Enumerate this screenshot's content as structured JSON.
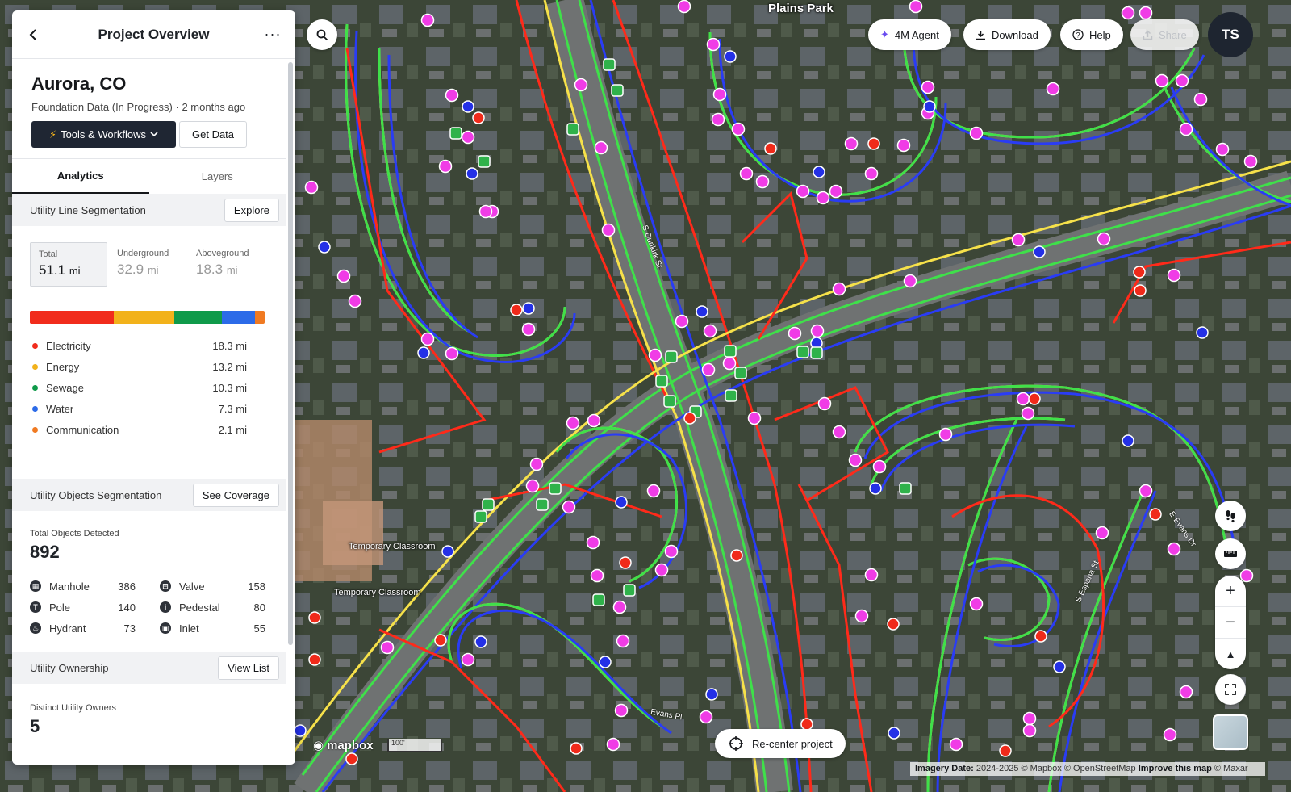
{
  "colors": {
    "electricity": "#f12c1c",
    "energy": "#f2b21b",
    "sewage": "#0f9a4a",
    "water": "#2c6be8",
    "communication": "#f07a22",
    "map_green": "#3fe04a",
    "map_yellow": "#f6e14a",
    "map_blue": "#2a3cf5",
    "map_red": "#ff2a1a",
    "marker_magenta": "#f03ce6"
  },
  "map": {
    "place_label": "Plains Park",
    "labels": [
      "Temporary Classroom",
      "Temporary Classroom"
    ],
    "streets": [
      "S Dunkirk St",
      "E Evans Dr",
      "S Espana St",
      "Evans Pl"
    ],
    "attribution_date_label": "Imagery Date:",
    "attribution_date": "2024-2025",
    "attribution_rest": "© Mapbox © OpenStreetMap",
    "attribution_link": "Improve this map",
    "attribution_tail": "© Maxar",
    "mapbox_logo": "mapbox",
    "scale_label": "100'"
  },
  "panel": {
    "title": "Project Overview",
    "back_icon": "chevron-left-icon",
    "more_icon": "more-horizontal-icon",
    "more_glyph": "···",
    "project_name": "Aurora, CO",
    "project_status": "Foundation Data (In Progress)",
    "project_time": "2 months ago",
    "tools_label": "Tools & Workflows",
    "get_data_label": "Get Data",
    "tabs": [
      {
        "label": "Analytics",
        "active": true
      },
      {
        "label": "Layers",
        "active": false
      }
    ],
    "line_section": {
      "title": "Utility Line Segmentation",
      "button": "Explore",
      "stats": [
        {
          "label": "Total",
          "value": "51.1",
          "unit": "mi",
          "active": true
        },
        {
          "label": "Underground",
          "value": "32.9",
          "unit": "mi",
          "active": false
        },
        {
          "label": "Aboveground",
          "value": "18.3",
          "unit": "mi",
          "active": false
        }
      ],
      "legend": [
        {
          "name": "Electricity",
          "value": "18.3 mi",
          "miles": 18.3,
          "color": "#f12c1c"
        },
        {
          "name": "Energy",
          "value": "13.2 mi",
          "miles": 13.2,
          "color": "#f2b21b"
        },
        {
          "name": "Sewage",
          "value": "10.3 mi",
          "miles": 10.3,
          "color": "#0f9a4a"
        },
        {
          "name": "Water",
          "value": "7.3 mi",
          "miles": 7.3,
          "color": "#2c6be8"
        },
        {
          "name": "Communication",
          "value": "2.1 mi",
          "miles": 2.1,
          "color": "#f07a22"
        }
      ]
    },
    "objects_section": {
      "title": "Utility Objects Segmentation",
      "button": "See Coverage",
      "total_label": "Total Objects Detected",
      "total_value": "892",
      "items": [
        {
          "name": "Manhole",
          "value": "386",
          "icon": "manhole-icon",
          "glyph": "▦"
        },
        {
          "name": "Valve",
          "value": "158",
          "icon": "valve-icon",
          "glyph": "⊟"
        },
        {
          "name": "Pole",
          "value": "140",
          "icon": "pole-icon",
          "glyph": "T"
        },
        {
          "name": "Pedestal",
          "value": "80",
          "icon": "pedestal-icon",
          "glyph": "i"
        },
        {
          "name": "Hydrant",
          "value": "73",
          "icon": "hydrant-icon",
          "glyph": "♨"
        },
        {
          "name": "Inlet",
          "value": "55",
          "icon": "inlet-icon",
          "glyph": "▣"
        }
      ]
    },
    "ownership_section": {
      "title": "Utility Ownership",
      "button": "View List",
      "owners_label": "Distinct Utility Owners",
      "owners_value": "5"
    }
  },
  "toolbar": {
    "search_icon": "search-icon",
    "agent_label": "4M Agent",
    "download_label": "Download",
    "help_label": "Help",
    "share_label": "Share",
    "avatar_initials": "TS"
  },
  "controls": {
    "street_view_icon": "footprints-icon",
    "measure_icon": "ruler-icon",
    "zoom_in_glyph": "+",
    "zoom_out_glyph": "−",
    "compass_glyph": "▲",
    "fullscreen_glyph": "⛶",
    "recenter_label": "Re-center project"
  }
}
